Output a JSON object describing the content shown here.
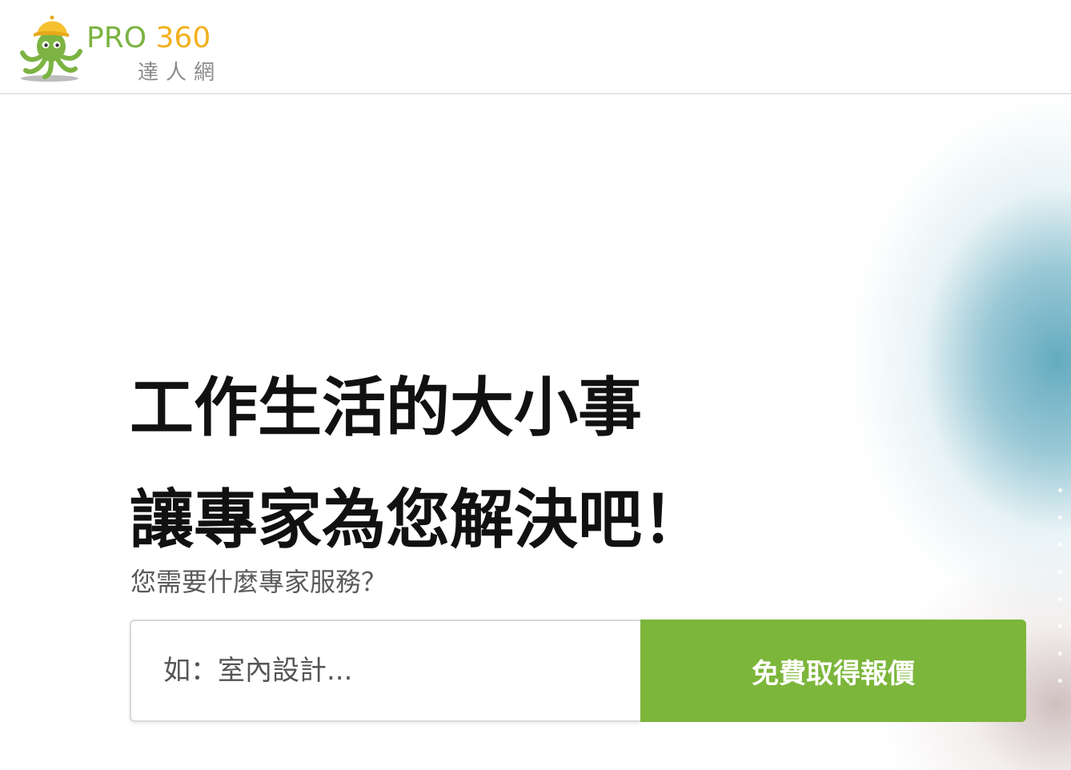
{
  "brand": {
    "word_pro": "PRO",
    "word_num": "360",
    "subtitle": "達人網",
    "colors": {
      "green": "#7cb342",
      "yellow": "#f2b01e"
    },
    "mascot_icon": "octopus-with-cap-icon"
  },
  "hero": {
    "headline_line1": "工作生活的大小事",
    "headline_line2": "讓專家為您解決吧！",
    "prompt": "您需要什麼專家服務？",
    "search": {
      "placeholder": "如：室內設計...",
      "value": ""
    },
    "cta_label": "免費取得報價",
    "cta_color": "#7cb63a"
  }
}
